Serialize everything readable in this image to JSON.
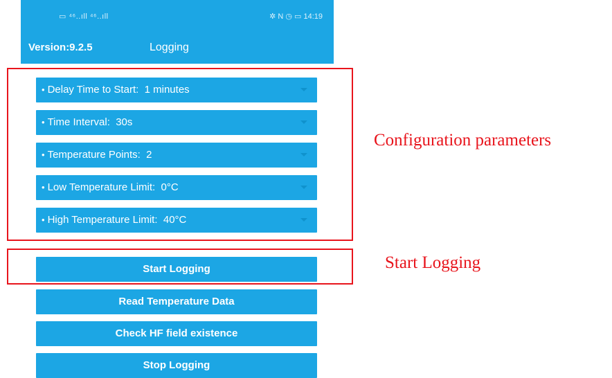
{
  "status_bar": {
    "left": "▭ ⁴⁶..ıll ⁴⁶..ıll",
    "right": "✲ N ◷ ▭ 14:19"
  },
  "header": {
    "version": "Version:9.2.5",
    "title": "Logging"
  },
  "parameters": [
    {
      "label": "Delay Time to Start:",
      "value": "1 minutes"
    },
    {
      "label": "Time Interval:",
      "value": "30s"
    },
    {
      "label": "Temperature Points:",
      "value": "2"
    },
    {
      "label": "Low Temperature Limit:",
      "value": "0°C"
    },
    {
      "label": "High Temperature Limit:",
      "value": "40°C"
    }
  ],
  "buttons": {
    "start": "Start Logging",
    "read": "Read Temperature Data",
    "check": "Check HF field existence",
    "stop": "Stop Logging"
  },
  "annotations": {
    "config": "Configuration parameters",
    "start": "Start Logging"
  },
  "colors": {
    "accent": "#1ca6e4",
    "annotation": "#e8141c"
  }
}
